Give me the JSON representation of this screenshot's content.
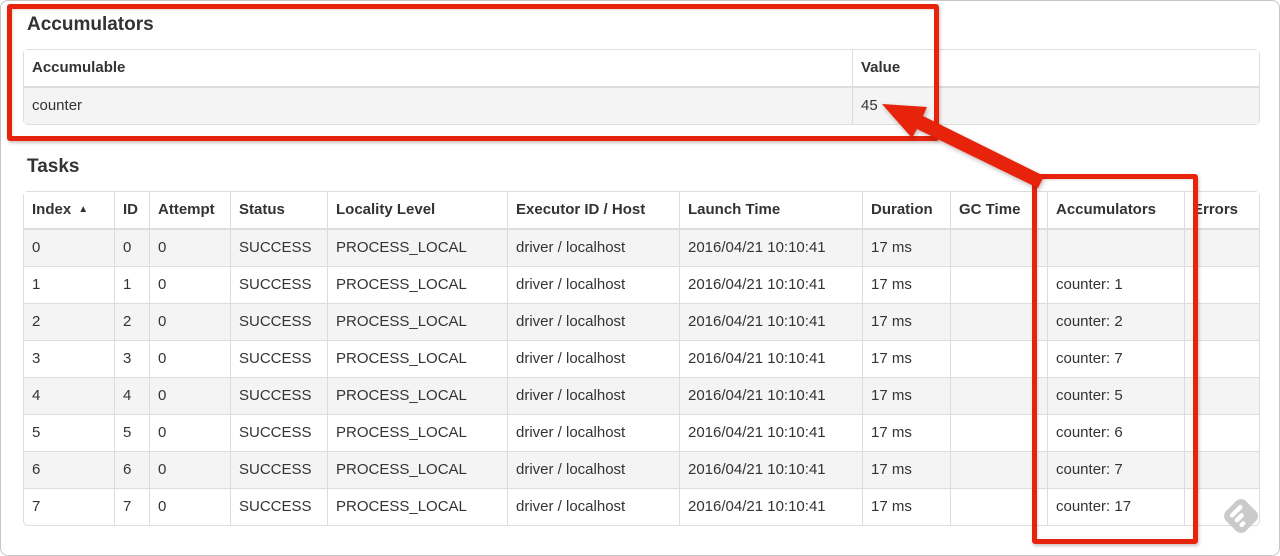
{
  "accumulators": {
    "title": "Accumulators",
    "headers": [
      "Accumulable",
      "Value"
    ],
    "row": {
      "name": "counter",
      "value": "45"
    }
  },
  "tasks": {
    "title": "Tasks",
    "headers": [
      "Index",
      "ID",
      "Attempt",
      "Status",
      "Locality Level",
      "Executor ID / Host",
      "Launch Time",
      "Duration",
      "GC Time",
      "Accumulators",
      "Errors"
    ],
    "column_keys": [
      "index",
      "id",
      "attempt",
      "status",
      "locality-level",
      "executor-id-host",
      "launch-time",
      "duration",
      "gc-time",
      "accumulators",
      "errors"
    ],
    "sort": {
      "column": "Index",
      "direction": "ascending",
      "indicator": "▲"
    },
    "rows": [
      [
        "0",
        "0",
        "0",
        "SUCCESS",
        "PROCESS_LOCAL",
        "driver / localhost",
        "2016/04/21 10:10:41",
        "17 ms",
        "",
        "",
        ""
      ],
      [
        "1",
        "1",
        "0",
        "SUCCESS",
        "PROCESS_LOCAL",
        "driver / localhost",
        "2016/04/21 10:10:41",
        "17 ms",
        "",
        "counter: 1",
        ""
      ],
      [
        "2",
        "2",
        "0",
        "SUCCESS",
        "PROCESS_LOCAL",
        "driver / localhost",
        "2016/04/21 10:10:41",
        "17 ms",
        "",
        "counter: 2",
        ""
      ],
      [
        "3",
        "3",
        "0",
        "SUCCESS",
        "PROCESS_LOCAL",
        "driver / localhost",
        "2016/04/21 10:10:41",
        "17 ms",
        "",
        "counter: 7",
        ""
      ],
      [
        "4",
        "4",
        "0",
        "SUCCESS",
        "PROCESS_LOCAL",
        "driver / localhost",
        "2016/04/21 10:10:41",
        "17 ms",
        "",
        "counter: 5",
        ""
      ],
      [
        "5",
        "5",
        "0",
        "SUCCESS",
        "PROCESS_LOCAL",
        "driver / localhost",
        "2016/04/21 10:10:41",
        "17 ms",
        "",
        "counter: 6",
        ""
      ],
      [
        "6",
        "6",
        "0",
        "SUCCESS",
        "PROCESS_LOCAL",
        "driver / localhost",
        "2016/04/21 10:10:41",
        "17 ms",
        "",
        "counter: 7",
        ""
      ],
      [
        "7",
        "7",
        "0",
        "SUCCESS",
        "PROCESS_LOCAL",
        "driver / localhost",
        "2016/04/21 10:10:41",
        "17 ms",
        "",
        "counter: 17",
        ""
      ]
    ]
  },
  "annotations": {
    "accent_color": "#e8230c",
    "box_1_target": "accumulators-section",
    "box_2_target": "tasks-accumulators-column",
    "arrow_target": "value-45"
  },
  "watermark": {
    "icon_name": "feedly-logo",
    "color": "#cacaca"
  }
}
